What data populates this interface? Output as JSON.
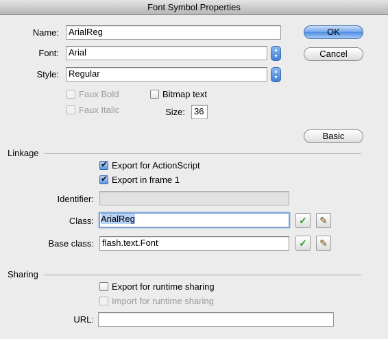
{
  "window": {
    "title": "Font Symbol Properties"
  },
  "form": {
    "name_label": "Name:",
    "name_value": "ArialReg",
    "font_label": "Font:",
    "font_value": "Arial",
    "style_label": "Style:",
    "style_value": "Regular",
    "faux_bold": "Faux Bold",
    "faux_italic": "Faux Italic",
    "bitmap_text": "Bitmap text",
    "size_label": "Size:",
    "size_value": "36"
  },
  "buttons": {
    "ok": "OK",
    "cancel": "Cancel",
    "basic": "Basic"
  },
  "linkage": {
    "title": "Linkage",
    "export_actionscript": "Export for ActionScript",
    "export_frame1": "Export in frame 1",
    "identifier_label": "Identifier:",
    "identifier_value": "",
    "class_label": "Class:",
    "class_value": "ArialReg",
    "base_class_label": "Base class:",
    "base_class_value": "flash.text.Font"
  },
  "sharing": {
    "title": "Sharing",
    "export_runtime": "Export for runtime sharing",
    "import_runtime": "Import for runtime sharing",
    "url_label": "URL:",
    "url_value": ""
  },
  "icons": {
    "stepper": "up-down-arrows",
    "validate": "green-checkmark",
    "edit": "pencil"
  }
}
